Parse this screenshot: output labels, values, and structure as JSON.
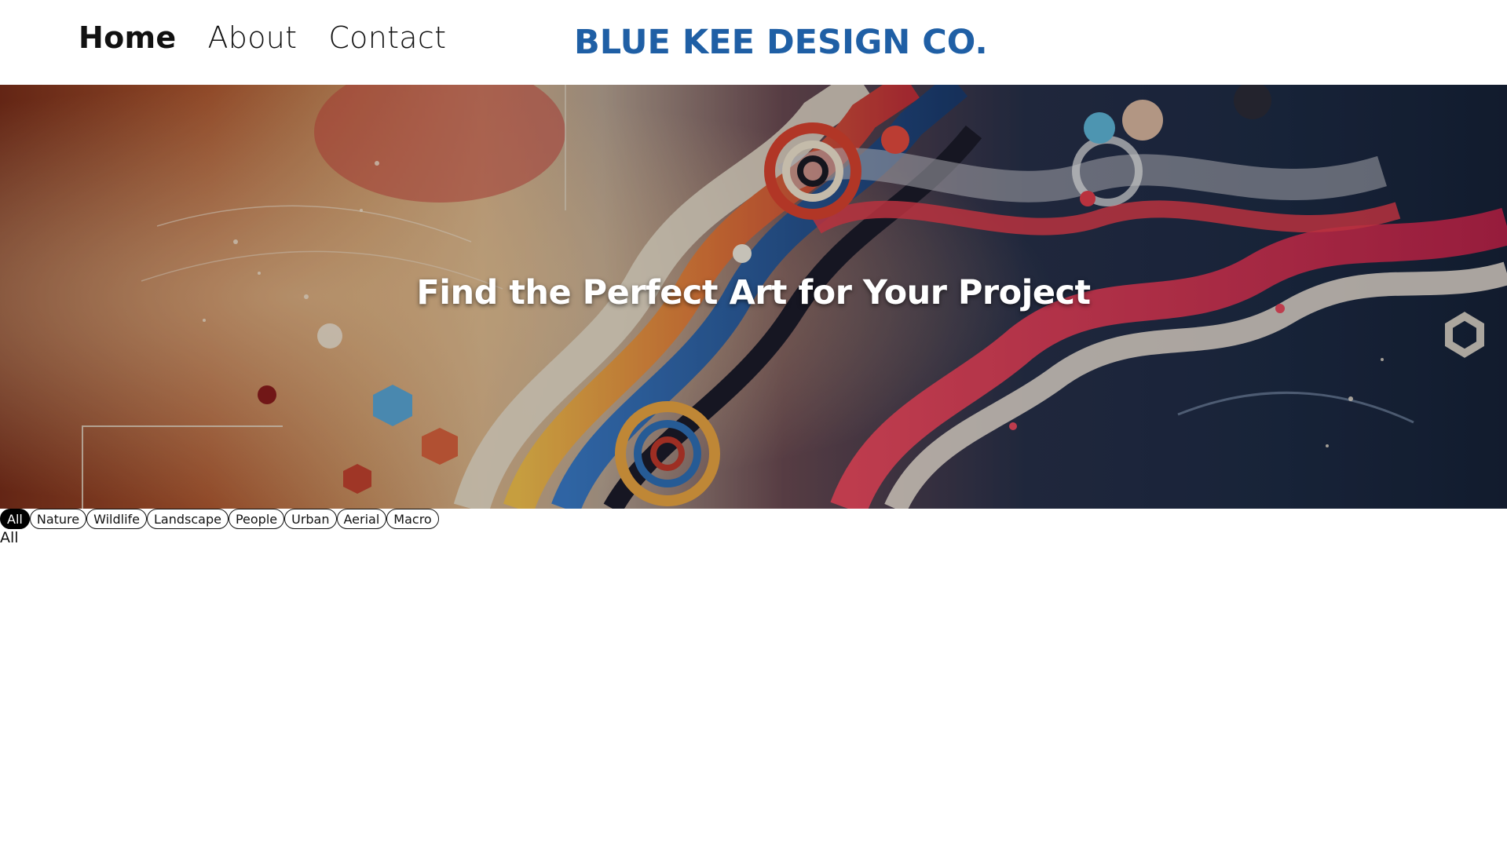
{
  "header": {
    "nav": [
      {
        "label": "Home",
        "active": true
      },
      {
        "label": "About",
        "active": false
      },
      {
        "label": "Contact",
        "active": false
      }
    ],
    "brand": "BLUE KEE DESIGN CO.",
    "brand_color": "#1f5fa5"
  },
  "hero": {
    "title": "Find the Perfect Art for Your Project",
    "image_icon": "abstract-art-banner"
  },
  "filters": {
    "chips": [
      "All",
      "Nature",
      "Wildlife",
      "Landscape",
      "People",
      "Urban",
      "Aerial",
      "Macro"
    ],
    "active": "All",
    "selected_label": "All"
  }
}
